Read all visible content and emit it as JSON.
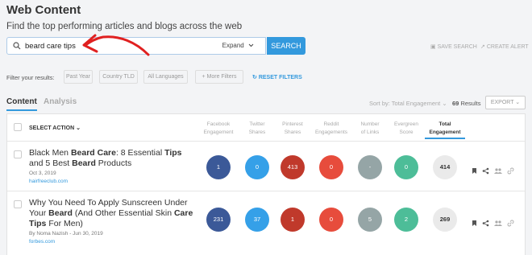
{
  "header": {
    "title": "Web Content",
    "subtitle": "Find the top performing articles and blogs across the web"
  },
  "search": {
    "value": "beard care tips",
    "expand_label": "Expand",
    "button_label": "SEARCH"
  },
  "top_actions": {
    "save_search": "SAVE SEARCH",
    "create_alert": "CREATE ALERT"
  },
  "filters": {
    "label": "Filter your results:",
    "pills": [
      "Past Year",
      "Country TLD",
      "All Languages",
      "+ More Filters"
    ],
    "reset_label": "RESET FILTERS"
  },
  "tabs": {
    "active": "Content",
    "inactive": "Analysis"
  },
  "sort": {
    "label": "Sort by: Total Engagement",
    "results_count": "69",
    "results_word": "Results",
    "export_label": "EXPORT"
  },
  "table": {
    "select_action": "SELECT ACTION",
    "columns": [
      {
        "l1": "Facebook",
        "l2": "Engagement"
      },
      {
        "l1": "Twitter",
        "l2": "Shares"
      },
      {
        "l1": "Pinterest",
        "l2": "Shares"
      },
      {
        "l1": "Reddit",
        "l2": "Engagements"
      },
      {
        "l1": "Number",
        "l2": "of Links"
      },
      {
        "l1": "Evergreen",
        "l2": "Score"
      },
      {
        "l1": "Total",
        "l2": "Engagement"
      }
    ],
    "rows": [
      {
        "title_html": "Black Men <b>Beard Care</b>: 8 Essential <b>Tips</b> and 5 Best <b>Beard</b> Products",
        "meta": "Oct 3, 2019",
        "domain": "hairfreeclub.com",
        "metrics": [
          "1",
          "0",
          "413",
          "0",
          "-",
          "0",
          "414"
        ]
      },
      {
        "title_html": "Why You Need To Apply Sunscreen Under Your <b>Beard</b> (And Other Essential Skin <b>Care Tips</b> For Men)",
        "meta": "By Noma Nazish - Jun 30, 2019",
        "domain": "forbes.com",
        "metrics": [
          "231",
          "37",
          "1",
          "0",
          "5",
          "2",
          "269"
        ]
      }
    ]
  },
  "colors": {
    "facebook": "#3b5998",
    "twitter": "#35a0e8",
    "pinterest": "#c0392b",
    "reddit": "#e74c3c",
    "links": "#95a5a6",
    "evergreen": "#4dbd98",
    "total": "#eaeaea",
    "accent": "#3399dd"
  },
  "annotation": "red arrow pointing to search input"
}
